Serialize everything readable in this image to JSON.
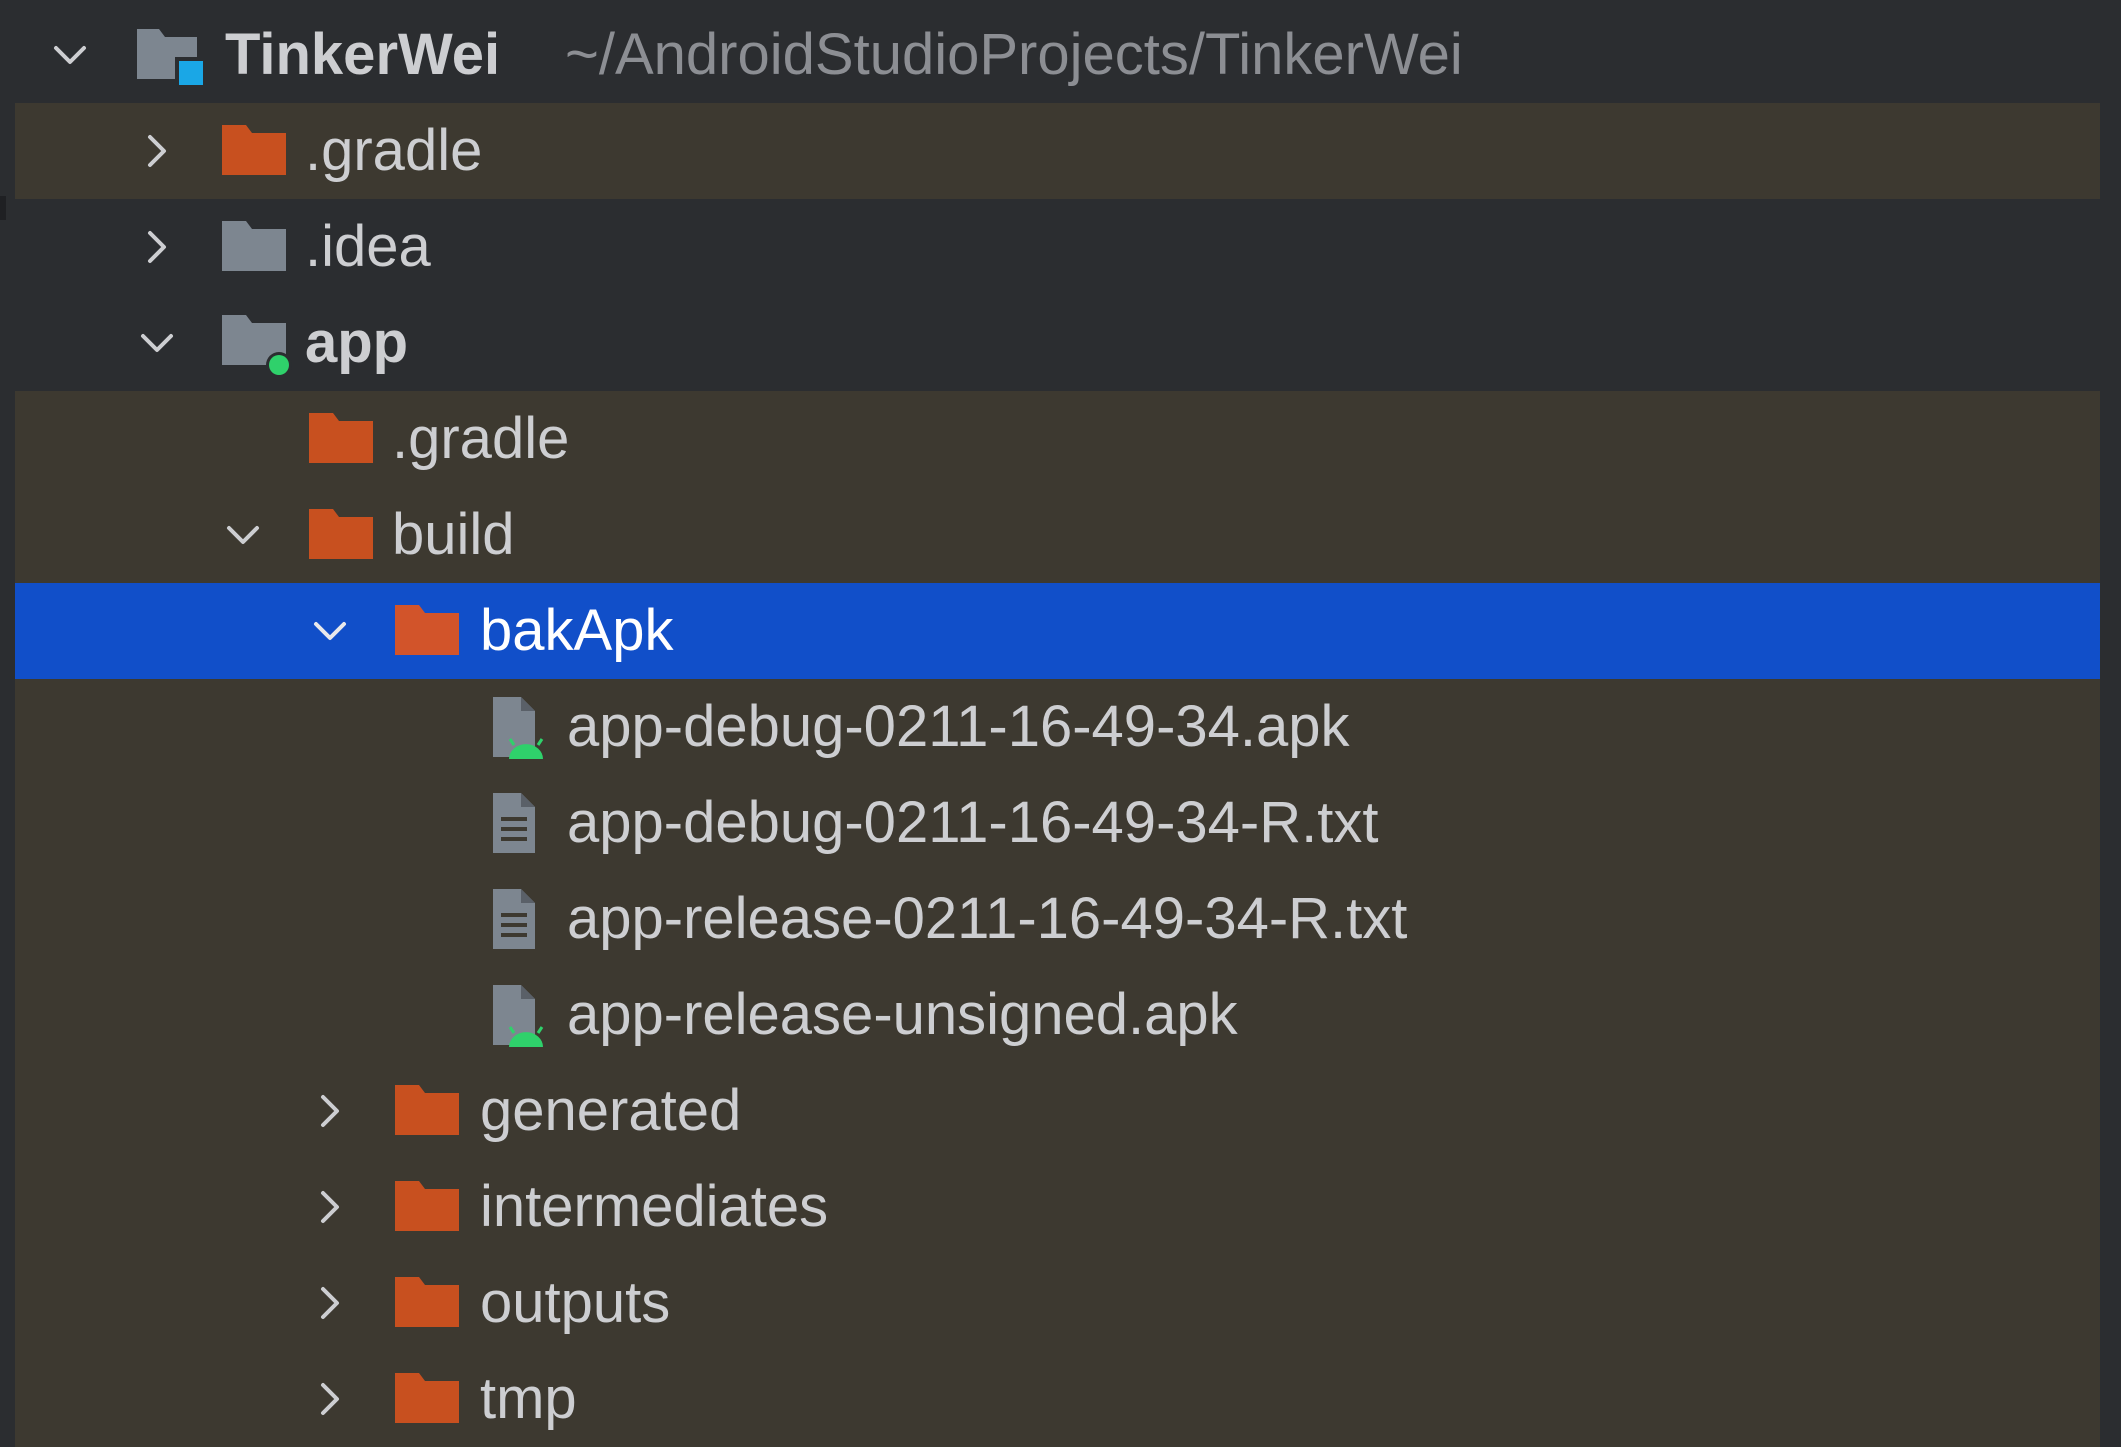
{
  "project": {
    "name": "TinkerWei",
    "path": "~/AndroidStudioProjects/TinkerWei"
  },
  "tree": {
    "gradle_root": ".gradle",
    "idea": ".idea",
    "app": "app",
    "app_gradle": ".gradle",
    "build": "build",
    "bakApk": "bakApk",
    "files": [
      "app-debug-0211-16-49-34.apk",
      "app-debug-0211-16-49-34-R.txt",
      "app-release-0211-16-49-34-R.txt",
      "app-release-unsigned.apk"
    ],
    "generated": "generated",
    "intermediates": "intermediates",
    "outputs": "outputs",
    "tmp": "tmp"
  },
  "colors": {
    "excluded_folder": "#c8501f",
    "plain_folder": "#7d8690",
    "selection": "#114fc9",
    "android_green": "#2fd16b",
    "module_dot": "#2fd16b",
    "project_badge": "#1aa7e6"
  },
  "icons": {
    "expanded": "chevron-down-icon",
    "collapsed": "chevron-right-icon",
    "project": "project-folder-icon",
    "excluded_folder": "excluded-folder-icon",
    "plain_folder": "folder-icon",
    "module": "module-folder-icon",
    "apk": "apk-file-icon",
    "text": "text-file-icon"
  }
}
